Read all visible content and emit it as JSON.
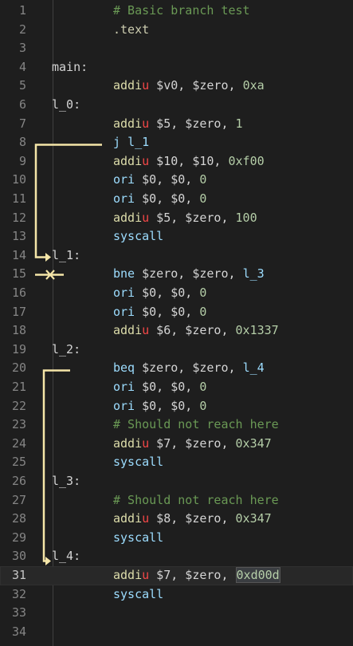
{
  "editor": {
    "lines": [
      {
        "n": "1",
        "i": 1,
        "t": [
          {
            "c": "c-comment",
            "v": "# Basic branch test"
          }
        ]
      },
      {
        "n": "2",
        "i": 1,
        "t": [
          {
            "c": "c-directive",
            "v": ".text"
          }
        ]
      },
      {
        "n": "3",
        "i": 0,
        "t": []
      },
      {
        "n": "4",
        "i": 0,
        "t": [
          {
            "c": "c-label",
            "v": "main:"
          }
        ]
      },
      {
        "n": "5",
        "i": 1,
        "t": [
          {
            "c": "c-op-a",
            "v": "addi"
          },
          {
            "c": "c-op-b",
            "v": "u"
          },
          {
            "c": "c-text",
            "v": " $v0, $zero, "
          },
          {
            "c": "c-num",
            "v": "0xa"
          }
        ]
      },
      {
        "n": "6",
        "i": 0,
        "t": [
          {
            "c": "c-label",
            "v": "l_0:"
          }
        ]
      },
      {
        "n": "7",
        "i": 1,
        "t": [
          {
            "c": "c-op-a",
            "v": "addi"
          },
          {
            "c": "c-op-b",
            "v": "u"
          },
          {
            "c": "c-text",
            "v": " $5, $zero, "
          },
          {
            "c": "c-num",
            "v": "1"
          }
        ]
      },
      {
        "n": "8",
        "i": 1,
        "t": [
          {
            "c": "c-op",
            "v": "j"
          },
          {
            "c": "c-text",
            "v": " "
          },
          {
            "c": "c-op",
            "v": "l_1"
          }
        ]
      },
      {
        "n": "9",
        "i": 1,
        "t": [
          {
            "c": "c-op-a",
            "v": "addi"
          },
          {
            "c": "c-op-b",
            "v": "u"
          },
          {
            "c": "c-text",
            "v": " $10, $10, "
          },
          {
            "c": "c-num",
            "v": "0xf00"
          }
        ]
      },
      {
        "n": "10",
        "i": 1,
        "t": [
          {
            "c": "c-op",
            "v": "ori"
          },
          {
            "c": "c-text",
            "v": " $0, $0, "
          },
          {
            "c": "c-num",
            "v": "0"
          }
        ]
      },
      {
        "n": "11",
        "i": 1,
        "t": [
          {
            "c": "c-op",
            "v": "ori"
          },
          {
            "c": "c-text",
            "v": " $0, $0, "
          },
          {
            "c": "c-num",
            "v": "0"
          }
        ]
      },
      {
        "n": "12",
        "i": 1,
        "t": [
          {
            "c": "c-op-a",
            "v": "addi"
          },
          {
            "c": "c-op-b",
            "v": "u"
          },
          {
            "c": "c-text",
            "v": " $5, $zero, "
          },
          {
            "c": "c-num",
            "v": "100"
          }
        ]
      },
      {
        "n": "13",
        "i": 1,
        "t": [
          {
            "c": "c-op",
            "v": "syscall"
          }
        ]
      },
      {
        "n": "14",
        "i": 0,
        "t": [
          {
            "c": "c-label",
            "v": "l_1:"
          }
        ]
      },
      {
        "n": "15",
        "i": 1,
        "t": [
          {
            "c": "c-op",
            "v": "bne"
          },
          {
            "c": "c-text",
            "v": " $zero, $zero, "
          },
          {
            "c": "c-op",
            "v": "l_3"
          }
        ]
      },
      {
        "n": "16",
        "i": 1,
        "t": [
          {
            "c": "c-op",
            "v": "ori"
          },
          {
            "c": "c-text",
            "v": " $0, $0, "
          },
          {
            "c": "c-num",
            "v": "0"
          }
        ]
      },
      {
        "n": "17",
        "i": 1,
        "t": [
          {
            "c": "c-op",
            "v": "ori"
          },
          {
            "c": "c-text",
            "v": " $0, $0, "
          },
          {
            "c": "c-num",
            "v": "0"
          }
        ]
      },
      {
        "n": "18",
        "i": 1,
        "t": [
          {
            "c": "c-op-a",
            "v": "addi"
          },
          {
            "c": "c-op-b",
            "v": "u"
          },
          {
            "c": "c-text",
            "v": " $6, $zero, "
          },
          {
            "c": "c-num",
            "v": "0x1337"
          }
        ]
      },
      {
        "n": "19",
        "i": 0,
        "t": [
          {
            "c": "c-label",
            "v": "l_2:"
          }
        ]
      },
      {
        "n": "20",
        "i": 1,
        "t": [
          {
            "c": "c-op",
            "v": "beq"
          },
          {
            "c": "c-text",
            "v": " $zero, $zero, "
          },
          {
            "c": "c-op",
            "v": "l_4"
          }
        ]
      },
      {
        "n": "21",
        "i": 1,
        "t": [
          {
            "c": "c-op",
            "v": "ori"
          },
          {
            "c": "c-text",
            "v": " $0, $0, "
          },
          {
            "c": "c-num",
            "v": "0"
          }
        ]
      },
      {
        "n": "22",
        "i": 1,
        "t": [
          {
            "c": "c-op",
            "v": "ori"
          },
          {
            "c": "c-text",
            "v": " $0, $0, "
          },
          {
            "c": "c-num",
            "v": "0"
          }
        ]
      },
      {
        "n": "23",
        "i": 1,
        "t": [
          {
            "c": "c-comment",
            "v": "# Should not reach here"
          }
        ]
      },
      {
        "n": "24",
        "i": 1,
        "t": [
          {
            "c": "c-op-a",
            "v": "addi"
          },
          {
            "c": "c-op-b",
            "v": "u"
          },
          {
            "c": "c-text",
            "v": " $7, $zero, "
          },
          {
            "c": "c-num",
            "v": "0x347"
          }
        ]
      },
      {
        "n": "25",
        "i": 1,
        "t": [
          {
            "c": "c-op",
            "v": "syscall"
          }
        ]
      },
      {
        "n": "26",
        "i": 0,
        "t": [
          {
            "c": "c-label",
            "v": "l_3:"
          }
        ]
      },
      {
        "n": "27",
        "i": 1,
        "t": [
          {
            "c": "c-comment",
            "v": "# Should not reach here"
          }
        ]
      },
      {
        "n": "28",
        "i": 1,
        "t": [
          {
            "c": "c-op-a",
            "v": "addi"
          },
          {
            "c": "c-op-b",
            "v": "u"
          },
          {
            "c": "c-text",
            "v": " $8, $zero, "
          },
          {
            "c": "c-num",
            "v": "0x347"
          }
        ]
      },
      {
        "n": "29",
        "i": 1,
        "t": [
          {
            "c": "c-op",
            "v": "syscall"
          }
        ]
      },
      {
        "n": "30",
        "i": 0,
        "t": [
          {
            "c": "c-label",
            "v": "l_4:"
          }
        ]
      },
      {
        "n": "31",
        "i": 1,
        "cur": true,
        "t": [
          {
            "c": "c-op-a",
            "v": "addi"
          },
          {
            "c": "c-op-b",
            "v": "u"
          },
          {
            "c": "c-text",
            "v": " $7, $zero, "
          },
          {
            "c": "c-num hl",
            "v": "0xd00d"
          }
        ]
      },
      {
        "n": "32",
        "i": 1,
        "t": [
          {
            "c": "c-op",
            "v": "syscall"
          }
        ]
      },
      {
        "n": "33",
        "i": 0,
        "t": []
      },
      {
        "n": "34",
        "i": 0,
        "t": []
      }
    ],
    "arrow_color": "#f5e6a8",
    "current_line": "31"
  }
}
